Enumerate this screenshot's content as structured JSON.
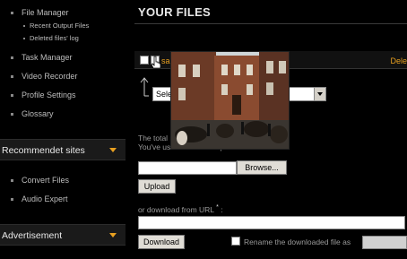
{
  "sidebar": {
    "file_manager": "File Manager",
    "recent_output_files": "Recent Output Files",
    "deleted_files_log": "Deleted files' log",
    "task_manager": "Task Manager",
    "video_recorder": "Video Recorder",
    "profile_settings": "Profile Settings",
    "glossary": "Glossary",
    "recommended_header": "Recommendet sites",
    "convert_files": "Convert Files",
    "audio_expert": "Audio Expert",
    "advertisement_header": "Advertisement"
  },
  "main": {
    "title": "YOUR FILES",
    "select_label_fragment": "sa",
    "delete_fragment": "Dele",
    "select_value": "Sele",
    "info_line1": "The total                                              n (Standard) is 300 MB",
    "info_line2": "You've us                                          available for upload 286.41 MB",
    "browse_label": "Browse...",
    "upload_label": "Upload",
    "url_label": "or download from URL",
    "url_required": "*",
    "url_colon": ":",
    "download_label": "Download",
    "rename_label": "Rename the downloaded file as"
  },
  "colors": {
    "accent": "#e8a020",
    "background": "#000000",
    "text": "#bdbdbd"
  }
}
